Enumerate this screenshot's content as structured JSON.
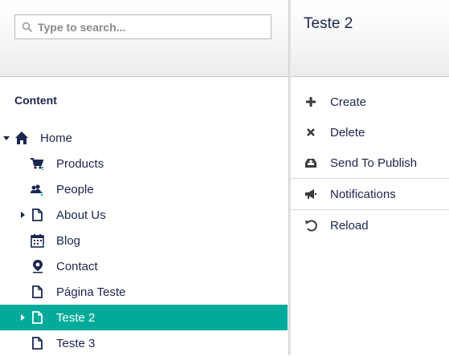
{
  "search": {
    "placeholder": "Type to search..."
  },
  "content": {
    "title": "Content",
    "tree": [
      {
        "label": "Home",
        "icon": "home-icon",
        "expanded": true
      },
      {
        "label": "Products",
        "icon": "cart-icon"
      },
      {
        "label": "People",
        "icon": "people-icon"
      },
      {
        "label": "About Us",
        "icon": "document-icon",
        "expandable": true
      },
      {
        "label": "Blog",
        "icon": "calendar-icon"
      },
      {
        "label": "Contact",
        "icon": "map-pin-icon"
      },
      {
        "label": "Página Teste",
        "icon": "document-icon"
      },
      {
        "label": "Teste 2",
        "icon": "document-icon",
        "expandable": true,
        "selected": true
      },
      {
        "label": "Teste 3",
        "icon": "document-icon"
      }
    ]
  },
  "right": {
    "title": "Teste 2",
    "actions": [
      {
        "label": "Create",
        "icon": "plus-icon"
      },
      {
        "label": "Delete",
        "icon": "close-icon"
      },
      {
        "label": "Send To Publish",
        "icon": "publish-icon"
      },
      {
        "label": "Notifications",
        "icon": "megaphone-icon"
      },
      {
        "label": "Reload",
        "icon": "reload-icon"
      }
    ]
  },
  "colors": {
    "accent": "#00ab9b",
    "text": "#1b264f"
  }
}
